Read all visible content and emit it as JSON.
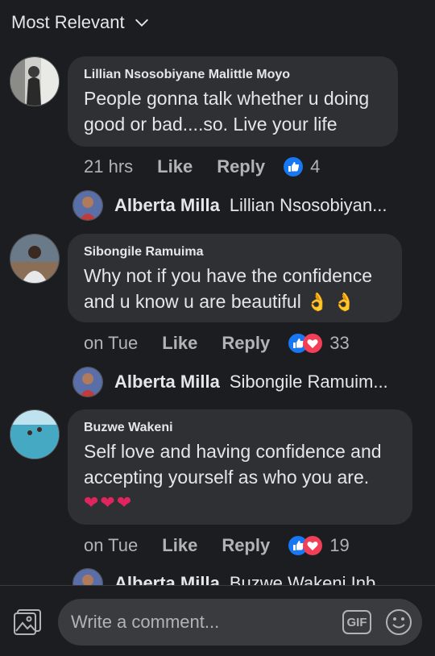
{
  "sort": {
    "label": "Most Relevant"
  },
  "comments": [
    {
      "author": "Lillian Nsosobiyane Malittle Moyo",
      "text": "People gonna talk whether u doing good or bad....so.  Live your life",
      "time": "21 hrs",
      "like": "Like",
      "reply": "Reply",
      "reaction_count": "4",
      "reactions": [
        "like-icon"
      ],
      "reply_preview": {
        "name": "Alberta Milla",
        "text": "Lillian Nsosobiyan..."
      }
    },
    {
      "author": "Sibongile Ramuima",
      "text": "Why not if you have the confidence and u know u are beautiful",
      "emoji": "👌 👌",
      "time": "on Tue",
      "like": "Like",
      "reply": "Reply",
      "reaction_count": "33",
      "reactions": [
        "like-icon",
        "love-icon"
      ],
      "reply_preview": {
        "name": "Alberta Milla",
        "text": "Sibongile Ramuim..."
      }
    },
    {
      "author": "Buzwe Wakeni",
      "text": "Self love and having confidence and accepting yourself as who you are.",
      "emoji": "❤❤❤",
      "time": "on Tue",
      "like": "Like",
      "reply": "Reply",
      "reaction_count": "19",
      "reactions": [
        "like-icon",
        "love-icon"
      ],
      "reply_preview": {
        "name": "Alberta Milla",
        "text": "Buzwe Wakeni Inb..."
      }
    }
  ],
  "composer": {
    "placeholder": "Write a comment...",
    "gif_label": "GIF"
  },
  "colors": {
    "like_blue": "#1877f2",
    "love_red": "#f33e58",
    "bubble": "#2f3034",
    "background": "#1c1d20"
  }
}
